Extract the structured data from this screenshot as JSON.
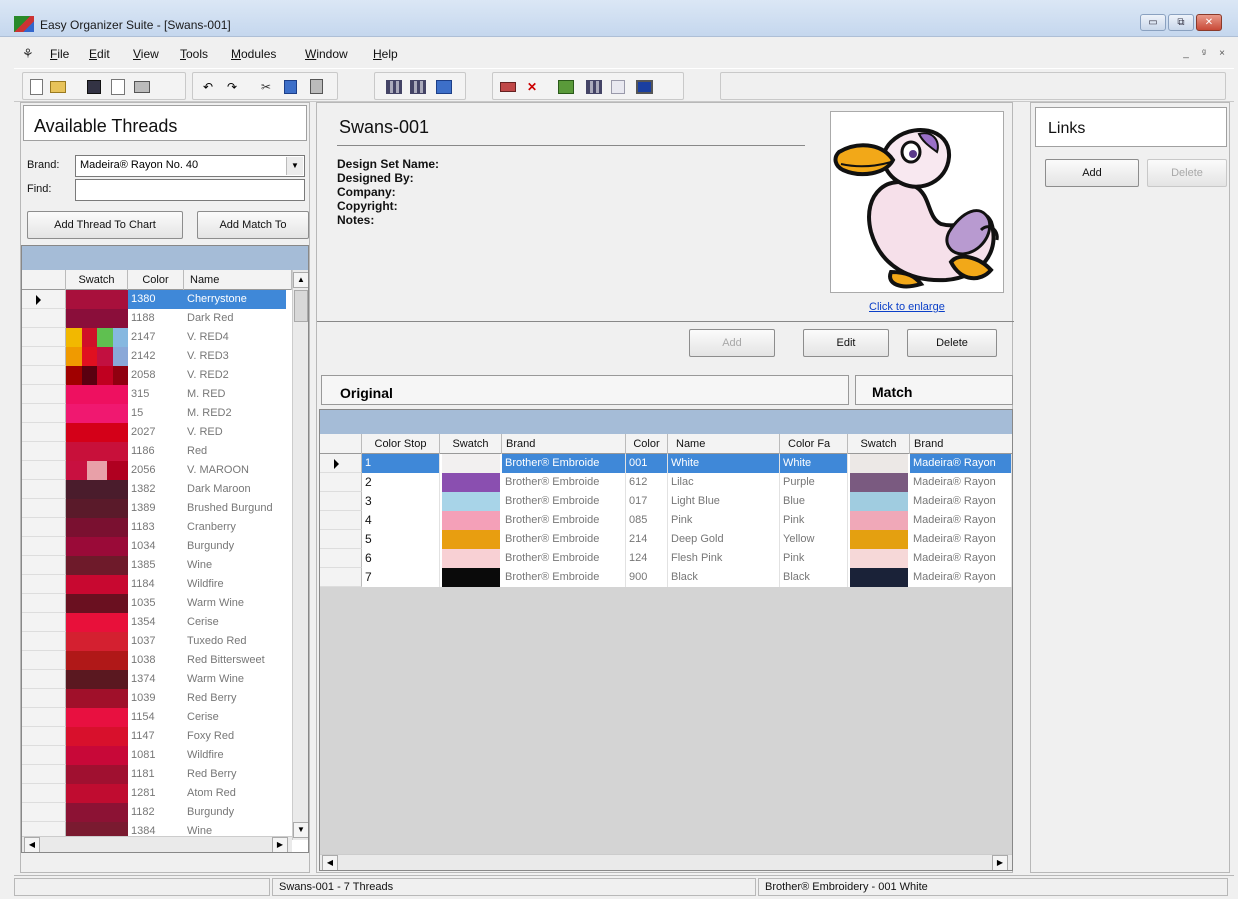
{
  "window": {
    "title": "Easy Organizer Suite - [Swans-001]",
    "min_glyph": "▭",
    "max_glyph": "⧉",
    "close_glyph": "✕"
  },
  "menu": {
    "logo_glyph": "⚘",
    "items": [
      {
        "u": "F",
        "rest": "ile"
      },
      {
        "u": "E",
        "rest": "dit"
      },
      {
        "u": "V",
        "rest": "iew"
      },
      {
        "u": "T",
        "rest": "ools"
      },
      {
        "u": "M",
        "rest": "odules"
      },
      {
        "u": "W",
        "rest": "indow"
      },
      {
        "u": "H",
        "rest": "elp"
      }
    ],
    "mdi_min": "_",
    "mdi_restore": "ᵍ",
    "mdi_close": "×"
  },
  "toolbar": {
    "icons": [
      "new-document-icon",
      "open-folder-icon",
      "save-icon",
      "print-preview-icon",
      "print-icon",
      "undo-icon",
      "redo-icon",
      "cut-icon",
      "copy-icon",
      "paste-icon",
      "grid-view-icon",
      "table-view-icon",
      "list-view-icon",
      "match-icon",
      "delete-icon",
      "export-icon",
      "chart-icon",
      "scale-icon",
      "monitor-icon"
    ],
    "undo_glyph": "↶",
    "redo_glyph": "↷",
    "cut_glyph": "✂",
    "delete_glyph": "✕"
  },
  "left": {
    "title": "Available Threads",
    "brand_label": "Brand:",
    "brand_value": "Madeira® Rayon No. 40",
    "find_label": "Find:",
    "find_value": "",
    "add_to_chart": "Add Thread To Chart",
    "add_match": "Add Match To",
    "columns": [
      "Swatch",
      "Color",
      "Name"
    ],
    "threads": [
      {
        "code": "1380",
        "name": "Cherrystone",
        "swatch": [
          "#a8103c"
        ],
        "selected": true
      },
      {
        "code": "1188",
        "name": "Dark Red",
        "swatch": [
          "#8a0e3a"
        ]
      },
      {
        "code": "2147",
        "name": "V. RED4",
        "swatch": [
          "#f2b800",
          "#d01028",
          "#5fc050",
          "#86b8e0"
        ]
      },
      {
        "code": "2142",
        "name": "V. RED3",
        "swatch": [
          "#f09a00",
          "#e01020",
          "#c21040",
          "#8aa8d8"
        ]
      },
      {
        "code": "2058",
        "name": "V. RED2",
        "swatch": [
          "#a00000",
          "#5a0010",
          "#c00020",
          "#900010"
        ]
      },
      {
        "code": "315",
        "name": "M. RED",
        "swatch": [
          "#ee1060"
        ]
      },
      {
        "code": "15",
        "name": "M. RED2",
        "swatch": [
          "#f01870"
        ]
      },
      {
        "code": "2027",
        "name": "V. RED",
        "swatch": [
          "#d40018"
        ]
      },
      {
        "code": "1186",
        "name": "Red",
        "swatch": [
          "#c8103a"
        ]
      },
      {
        "code": "2056",
        "name": "V. MAROON",
        "swatch": [
          "#c81040",
          "#e8a0a8",
          "#b00020"
        ]
      },
      {
        "code": "1382",
        "name": "Dark Maroon",
        "swatch": [
          "#4a1c2c"
        ]
      },
      {
        "code": "1389",
        "name": "Brushed Burgund",
        "swatch": [
          "#5a1a2a"
        ]
      },
      {
        "code": "1183",
        "name": "Cranberry",
        "swatch": [
          "#7a1030"
        ]
      },
      {
        "code": "1034",
        "name": "Burgundy",
        "swatch": [
          "#9a0a38"
        ]
      },
      {
        "code": "1385",
        "name": "Wine",
        "swatch": [
          "#6e1a2a"
        ]
      },
      {
        "code": "1184",
        "name": "Wildfire",
        "swatch": [
          "#c80830"
        ]
      },
      {
        "code": "1035",
        "name": "Warm Wine",
        "swatch": [
          "#6a1020"
        ]
      },
      {
        "code": "1354",
        "name": "Cerise",
        "swatch": [
          "#e8103a"
        ]
      },
      {
        "code": "1037",
        "name": "Tuxedo Red",
        "swatch": [
          "#d42030"
        ]
      },
      {
        "code": "1038",
        "name": "Red Bittersweet",
        "swatch": [
          "#b01818"
        ]
      },
      {
        "code": "1374",
        "name": "Warm Wine",
        "swatch": [
          "#5a1820"
        ]
      },
      {
        "code": "1039",
        "name": "Red Berry",
        "swatch": [
          "#a0102a"
        ]
      },
      {
        "code": "1154",
        "name": "Cerise",
        "swatch": [
          "#e81040"
        ]
      },
      {
        "code": "1147",
        "name": "Foxy Red",
        "swatch": [
          "#d8102c"
        ]
      },
      {
        "code": "1081",
        "name": "Wildfire",
        "swatch": [
          "#c80838"
        ]
      },
      {
        "code": "1181",
        "name": "Red Berry",
        "swatch": [
          "#a01030"
        ]
      },
      {
        "code": "1281",
        "name": "Atom Red",
        "swatch": [
          "#c00c30"
        ]
      },
      {
        "code": "1182",
        "name": "Burgundy",
        "swatch": [
          "#8c1234"
        ]
      },
      {
        "code": "1384",
        "name": "Wine",
        "swatch": [
          "#7a1a30"
        ]
      }
    ]
  },
  "design": {
    "name": "Swans-001",
    "fields": [
      "Design Set Name:",
      "Designed By:",
      "Company:",
      "Copyright:",
      "Notes:"
    ],
    "enlarge_link": "Click to enlarge",
    "add": "Add",
    "edit": "Edit",
    "delete": "Delete"
  },
  "chart": {
    "original_label": "Original",
    "match_label": "Match",
    "columns": [
      "Color Stop",
      "Swatch",
      "Brand",
      "Color",
      "Name",
      "Color Fa",
      "Swatch",
      "Brand"
    ],
    "rows": [
      {
        "stop": "1",
        "swatch": "#f2f0f0",
        "brand": "Brother® Embroide",
        "color": "001",
        "name": "White",
        "family": "White",
        "match_swatch": "#ece8e6",
        "match_brand": "Madeira® Rayon",
        "selected": true
      },
      {
        "stop": "2",
        "swatch": "#8a4fb0",
        "brand": "Brother® Embroide",
        "color": "612",
        "name": "Lilac",
        "family": "Purple",
        "match_swatch": "#7a5a80",
        "match_brand": "Madeira® Rayon"
      },
      {
        "stop": "3",
        "swatch": "#a8d4e8",
        "brand": "Brother® Embroide",
        "color": "017",
        "name": "Light Blue",
        "family": "Blue",
        "match_swatch": "#a0cce0",
        "match_brand": "Madeira® Rayon"
      },
      {
        "stop": "4",
        "swatch": "#f4a0b8",
        "brand": "Brother® Embroide",
        "color": "085",
        "name": "Pink",
        "family": "Pink",
        "match_swatch": "#f0a8b8",
        "match_brand": "Madeira® Rayon"
      },
      {
        "stop": "5",
        "swatch": "#e89e10",
        "brand": "Brother® Embroide",
        "color": "214",
        "name": "Deep Gold",
        "family": "Yellow",
        "match_swatch": "#e4a010",
        "match_brand": "Madeira® Rayon"
      },
      {
        "stop": "6",
        "swatch": "#f8d0d4",
        "brand": "Brother® Embroide",
        "color": "124",
        "name": "Flesh Pink",
        "family": "Pink",
        "match_swatch": "#f6d8d8",
        "match_brand": "Madeira® Rayon"
      },
      {
        "stop": "7",
        "swatch": "#0a0a0a",
        "brand": "Brother® Embroide",
        "color": "900",
        "name": "Black",
        "family": "Black",
        "match_swatch": "#1a2238",
        "match_brand": "Madeira® Rayon"
      }
    ]
  },
  "links": {
    "title": "Links",
    "add": "Add",
    "delete": "Delete"
  },
  "status": {
    "thread_count": "Swans-001 - 7 Threads",
    "selection": "Brother® Embroidery - 001 White"
  }
}
